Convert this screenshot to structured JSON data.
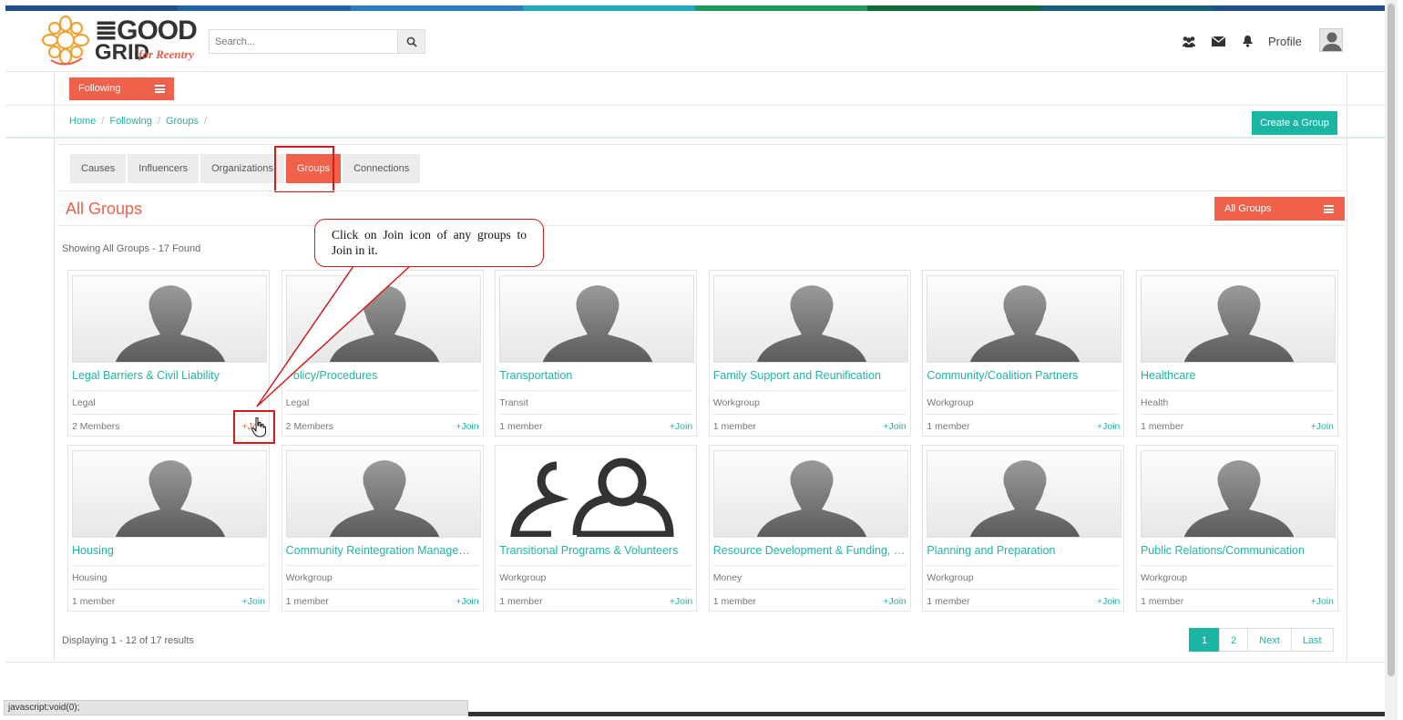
{
  "header": {
    "logo_line1": "≣GOOD",
    "logo_line2": "GRID",
    "logo_sub": "for Reentry",
    "search_placeholder": "Search...",
    "profile_label": "Profile",
    "icons": [
      "users-icon",
      "envelope-icon",
      "bell-icon",
      "search-icon"
    ],
    "topbar_colors": [
      "#1e4f8c",
      "#1f63a8",
      "#2b7fc0",
      "#1ea9c0",
      "#1c9a5c",
      "#0f6b3a",
      "#17607a",
      "#1e4f8c"
    ]
  },
  "nav": {
    "following_label": "Following",
    "breadcrumb": [
      "Home",
      "Following",
      "Groups"
    ],
    "create_group_label": "Create a Group"
  },
  "tabs": [
    {
      "label": "Causes",
      "active": false
    },
    {
      "label": "Influencers",
      "active": false
    },
    {
      "label": "Organizations",
      "active": false
    },
    {
      "label": "Groups",
      "active": true
    },
    {
      "label": "Connections",
      "active": false
    }
  ],
  "main": {
    "section_title": "All Groups",
    "filter_label": "All Groups",
    "showing_text": "Showing All Groups - 17 Found",
    "displaying_text": "Displaying 1 - 12 of 17 results"
  },
  "callout": {
    "text": "Click on Join icon of any groups to Join in it."
  },
  "groups": [
    {
      "name": "Legal Barriers & Civil Liability",
      "category": "Legal",
      "members": "2 Members",
      "join": "+Join",
      "image": "person"
    },
    {
      "name": "Policy/Procedures",
      "category": "Legal",
      "members": "2 Members",
      "join": "+Join",
      "image": "person"
    },
    {
      "name": "Transportation",
      "category": "Transit",
      "members": "1 member",
      "join": "+Join",
      "image": "person"
    },
    {
      "name": "Family Support and Reunification",
      "category": "Workgroup",
      "members": "1 member",
      "join": "+Join",
      "image": "person"
    },
    {
      "name": "Community/Coalition Partners",
      "category": "Workgroup",
      "members": "1 member",
      "join": "+Join",
      "image": "person"
    },
    {
      "name": "Healthcare",
      "category": "Health",
      "members": "1 member",
      "join": "+Join",
      "image": "person"
    },
    {
      "name": "Housing",
      "category": "Housing",
      "members": "1 member",
      "join": "+Join",
      "image": "person"
    },
    {
      "name": "Community Reintegration Management ...",
      "category": "Workgroup",
      "members": "1 member",
      "join": "+Join",
      "image": "person"
    },
    {
      "name": "Transitional Programs & Volunteers",
      "category": "Workgroup",
      "members": "1 member",
      "join": "+Join",
      "image": "group"
    },
    {
      "name": "Resource Development & Funding, Ince...",
      "category": "Money",
      "members": "1 member",
      "join": "+Join",
      "image": "person"
    },
    {
      "name": "Planning and Preparation",
      "category": "Workgroup",
      "members": "1 member",
      "join": "+Join",
      "image": "person"
    },
    {
      "name": "Public Relations/Communication",
      "category": "Workgroup",
      "members": "1 member",
      "join": "+Join",
      "image": "person"
    }
  ],
  "pagination": [
    "1",
    "2",
    "Next",
    "Last"
  ],
  "status_bar": "javascript:void(0);",
  "colors": {
    "accent": "#f0614b",
    "teal": "#1bb5a4",
    "highlight": "#d51b1b"
  }
}
